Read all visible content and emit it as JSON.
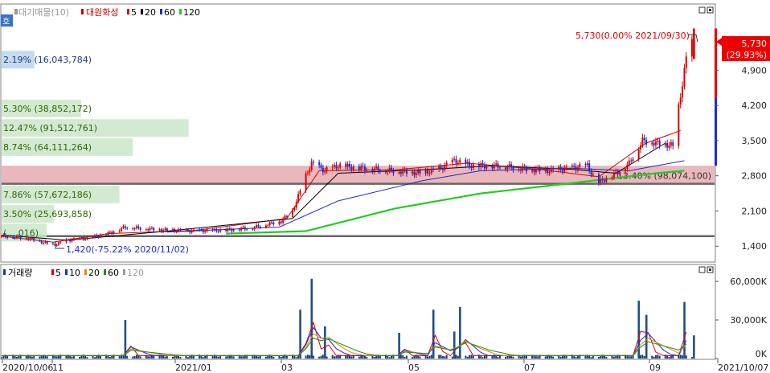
{
  "price_panel": {
    "code_badge": "호",
    "legend": {
      "series_dim": "대기매물(10)",
      "main": "대원화성",
      "ma": [
        {
          "label": "5",
          "color": "#dd0000"
        },
        {
          "label": "20",
          "color": "#000000"
        },
        {
          "label": "60",
          "color": "#1f2bd0"
        },
        {
          "label": "120",
          "color": "#22cc22"
        }
      ]
    },
    "max_annotation": "5,730(0.00% 2021/09/30)",
    "min_annotation": "1,420(-75.22% 2020/11/02)",
    "current_price": {
      "price": "5,730",
      "change": "(29.93%)"
    }
  },
  "volume_panel": {
    "legend": {
      "main": "거래량",
      "ma": [
        {
          "label": "5",
          "color": "#dd0000"
        },
        {
          "label": "10",
          "color": "#1f2bd0"
        },
        {
          "label": "20",
          "color": "#e08a00"
        },
        {
          "label": "60",
          "color": "#1f8a1f"
        },
        {
          "label": "120",
          "color": "#999999"
        }
      ]
    }
  },
  "x_axis": {
    "labels": [
      "2020/10/06",
      "11",
      "2021/01",
      "03",
      "05",
      "07",
      "09",
      "2021/10/07"
    ]
  },
  "chart_data": [
    {
      "type": "candlestick",
      "title": "대원화성",
      "ylim": [
        1100,
        6200
      ],
      "y_ticks": [
        {
          "label": "1,400",
          "value": 1400
        },
        {
          "label": "2,100",
          "value": 2100
        },
        {
          "label": "2,800",
          "value": 2800
        },
        {
          "label": "3,500",
          "value": 3500
        },
        {
          "label": "4,200",
          "value": 4200
        },
        {
          "label": "4,900",
          "value": 4900
        }
      ],
      "price_path": [
        [
          "2020-10-06",
          1600
        ],
        [
          "2020-10-20",
          1560
        ],
        [
          "2020-11-02",
          1420
        ],
        [
          "2020-11-10",
          1520
        ],
        [
          "2020-11-20",
          1560
        ],
        [
          "2020-11-30",
          1640
        ],
        [
          "2020-12-10",
          1780
        ],
        [
          "2020-12-31",
          1720
        ],
        [
          "2021-01-15",
          1700
        ],
        [
          "2021-02-01",
          1720
        ],
        [
          "2021-02-15",
          1770
        ],
        [
          "2021-03-02",
          1900
        ],
        [
          "2021-03-08",
          2100
        ],
        [
          "2021-03-15",
          2800
        ],
        [
          "2021-03-18",
          3050
        ],
        [
          "2021-03-25",
          2900
        ],
        [
          "2021-04-01",
          3000
        ],
        [
          "2021-04-15",
          2950
        ],
        [
          "2021-05-01",
          2900
        ],
        [
          "2021-05-15",
          2850
        ],
        [
          "2021-05-25",
          2950
        ],
        [
          "2021-06-01",
          3100
        ],
        [
          "2021-06-10",
          3000
        ],
        [
          "2021-06-25",
          3000
        ],
        [
          "2021-07-05",
          2950
        ],
        [
          "2021-07-20",
          2900
        ],
        [
          "2021-08-01",
          2950
        ],
        [
          "2021-08-10",
          3000
        ],
        [
          "2021-08-15",
          2650
        ],
        [
          "2021-08-25",
          2850
        ],
        [
          "2021-09-01",
          3050
        ],
        [
          "2021-09-08",
          3500
        ],
        [
          "2021-09-16",
          3450
        ],
        [
          "2021-09-24",
          3400
        ],
        [
          "2021-09-28",
          4400
        ],
        [
          "2021-10-01",
          5120
        ],
        [
          "2021-10-07",
          5730
        ]
      ],
      "current_price": 5730,
      "support_lines": [
        1600,
        2640
      ],
      "highlight_band": [
        2640,
        3000
      ],
      "volume_profile": [
        {
          "label": "2.19% (16,043,784)",
          "price": 5110,
          "pct": 2.19
        },
        {
          "label": "5.30% (38,852,172)",
          "price": 4140,
          "pct": 5.3
        },
        {
          "label": "12.47% (91,512,761)",
          "price": 3750,
          "pct": 12.47
        },
        {
          "label": "8.74% (64,111,264)",
          "price": 3370,
          "pct": 8.74
        },
        {
          "label": "13.40% (98,074,100)",
          "price": 2800,
          "pct": 13.4
        },
        {
          "label": "7.86% (57,672,186)",
          "price": 2430,
          "pct": 7.86
        },
        {
          "label": "3.50% (25,693,858)",
          "price": 2040,
          "pct": 3.5
        },
        {
          "label": "(…,016)",
          "price": 1670,
          "pct": 3.0
        }
      ],
      "moving_averages": {
        "ma5": [
          [
            "2020-10-06",
            1600
          ],
          [
            "2020-11-02",
            1480
          ],
          [
            "2020-12-01",
            1650
          ],
          [
            "2021-01-15",
            1710
          ],
          [
            "2021-03-05",
            1950
          ],
          [
            "2021-03-22",
            2900
          ],
          [
            "2021-05-01",
            2920
          ],
          [
            "2021-06-08",
            3050
          ],
          [
            "2021-07-15",
            2930
          ],
          [
            "2021-08-16",
            2780
          ],
          [
            "2021-09-10",
            3450
          ],
          [
            "2021-09-28",
            3700
          ]
        ],
        "ma20": [
          [
            "2020-10-06",
            1620
          ],
          [
            "2020-11-10",
            1520
          ],
          [
            "2021-01-01",
            1700
          ],
          [
            "2021-03-08",
            1950
          ],
          [
            "2021-04-01",
            2850
          ],
          [
            "2021-05-15",
            2920
          ],
          [
            "2021-06-20",
            3000
          ],
          [
            "2021-08-01",
            2930
          ],
          [
            "2021-08-25",
            2850
          ],
          [
            "2021-09-20",
            3450
          ]
        ],
        "ma60": [
          [
            "2021-01-01",
            1680
          ],
          [
            "2021-03-01",
            1780
          ],
          [
            "2021-04-01",
            2300
          ],
          [
            "2021-05-15",
            2700
          ],
          [
            "2021-06-15",
            2900
          ],
          [
            "2021-08-01",
            2950
          ],
          [
            "2021-09-01",
            2900
          ],
          [
            "2021-09-30",
            3100
          ]
        ],
        "ma120": [
          [
            "2021-02-01",
            1650
          ],
          [
            "2021-03-15",
            1700
          ],
          [
            "2021-05-01",
            2150
          ],
          [
            "2021-06-15",
            2450
          ],
          [
            "2021-08-01",
            2650
          ],
          [
            "2021-09-15",
            2850
          ],
          [
            "2021-09-30",
            2900
          ]
        ]
      }
    },
    {
      "type": "bar",
      "title": "거래량",
      "ylim": [
        0,
        70000
      ],
      "y_ticks": [
        {
          "label": "0K",
          "value": 0
        },
        {
          "label": "30,000K",
          "value": 30000
        },
        {
          "label": "60,000K",
          "value": 60000
        }
      ],
      "spikes": [
        {
          "x": "2020-12-10",
          "value": 30000
        },
        {
          "x": "2021-03-12",
          "value": 38000
        },
        {
          "x": "2021-03-18",
          "value": 62000
        },
        {
          "x": "2021-03-25",
          "value": 25000
        },
        {
          "x": "2021-05-03",
          "value": 20000
        },
        {
          "x": "2021-05-21",
          "value": 38000
        },
        {
          "x": "2021-06-01",
          "value": 21000
        },
        {
          "x": "2021-06-04",
          "value": 40000
        },
        {
          "x": "2021-09-06",
          "value": 45000
        },
        {
          "x": "2021-09-10",
          "value": 34000
        },
        {
          "x": "2021-09-30",
          "value": 44000
        },
        {
          "x": "2021-10-05",
          "value": 18000
        }
      ],
      "baseline_volume": 2500
    }
  ]
}
